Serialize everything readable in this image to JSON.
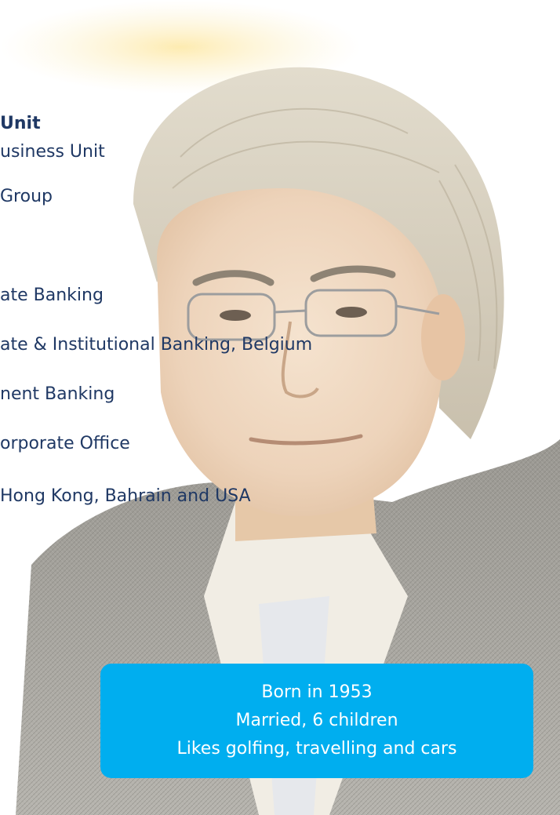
{
  "career": {
    "title": "Unit",
    "lines": [
      "usiness Unit",
      "Group",
      "ate Banking",
      "ate & Institutional Banking, Belgium",
      "nent Banking",
      "orporate Office",
      "Hong Kong, Bahrain and USA"
    ]
  },
  "personal": {
    "lines": [
      "Born in 1953",
      "Married, 6 children",
      "Likes golfing, travelling and cars"
    ]
  },
  "colors": {
    "text": "#1f3864",
    "info_box": "#00aeef",
    "info_text": "#ffffff"
  },
  "photo": {
    "subject": "portrait of older man with grey hair, glasses, dark grey jacket"
  }
}
